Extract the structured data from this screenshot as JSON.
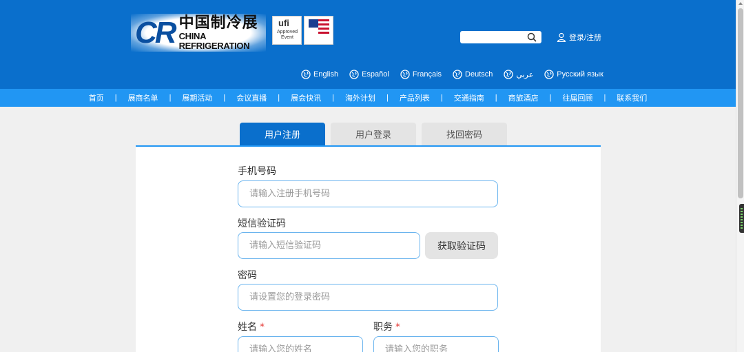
{
  "header": {
    "logo": {
      "mark": "CR",
      "name_cn": "中国制冷展",
      "name_en": "CHINA REFRIGERATION"
    },
    "ufi_badge": {
      "title": "ufi",
      "subtitle": "Approved Event"
    },
    "search": {
      "placeholder": "",
      "icon": "search-icon"
    },
    "login_label": "登录/注册",
    "languages": [
      {
        "label": "English",
        "icon": "globe-icon"
      },
      {
        "label": "Español",
        "icon": "globe-icon"
      },
      {
        "label": "Français",
        "icon": "globe-icon"
      },
      {
        "label": "Deutsch",
        "icon": "globe-icon"
      },
      {
        "label": "عربي",
        "icon": "globe-icon"
      },
      {
        "label": "Русский язык",
        "icon": "globe-icon"
      }
    ]
  },
  "nav": [
    "首页",
    "展商名单",
    "展期活动",
    "会议直播",
    "展会快讯",
    "海外计划",
    "产品列表",
    "交通指南",
    "商旅酒店",
    "往届回顾",
    "联系我们"
  ],
  "tabs": [
    "用户注册",
    "用户登录",
    "找回密码"
  ],
  "form": {
    "phone": {
      "label": "手机号码",
      "placeholder": "请输入注册手机号码"
    },
    "sms": {
      "label": "短信验证码",
      "placeholder": "请输入短信验证码",
      "button": "获取验证码"
    },
    "password": {
      "label": "密码",
      "placeholder": "请设置您的登录密码"
    },
    "name": {
      "label": "姓名",
      "required": "*",
      "placeholder": "请输入您的姓名"
    },
    "position": {
      "label": "职务",
      "required": "*",
      "placeholder": "请输入您的职务"
    }
  },
  "colors": {
    "header_bg": "#0a6fcc",
    "nav_bg": "#2196f3",
    "active_tab": "#0a6fcc",
    "input_border": "#6ab4ee",
    "required": "#e53935"
  }
}
